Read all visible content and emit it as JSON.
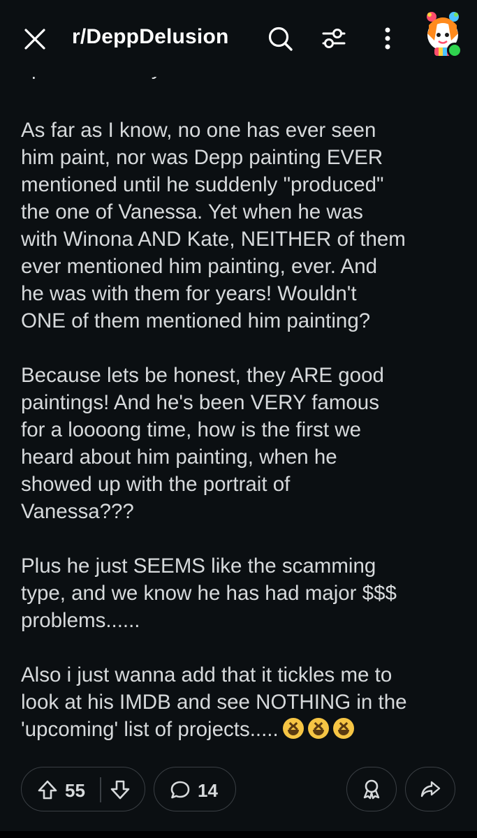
{
  "header": {
    "title": "r/DeppDelusion"
  },
  "post": {
    "cut_line": "split the money.",
    "paragraphs": [
      "As far as I know, no one has ever seen\nhim paint, nor was Depp painting EVER\nmentioned until he suddenly \"produced\"\nthe one of Vanessa. Yet when he was\nwith Winona AND Kate, NEITHER of them\never mentioned him painting, ever. And\nhe was with them for years! Wouldn't\nONE of them mentioned him painting?",
      "Because lets be honest, they ARE good\npaintings! And he's been VERY famous\nfor a loooong time, how is the first we\nheard about him painting, when he\nshowed up with the portrait of\nVanessa???",
      "Plus he just SEEMS like the scamming\ntype, and we know he has had major $$$\nproblems......",
      "Also i just wanna add that it tickles me to\nlook at his IMDB and see NOTHING in the\n'upcoming' list of projects....."
    ]
  },
  "actions": {
    "upvotes": "55",
    "comments": "14"
  },
  "colors": {
    "background": "#0b0f12",
    "text": "#d7dadc",
    "online": "#2fd34e"
  },
  "icons": [
    "close-icon",
    "search-icon",
    "filter-icon",
    "more-icon",
    "upvote-icon",
    "downvote-icon",
    "comment-icon",
    "award-icon",
    "share-icon",
    "laughing-emoji"
  ]
}
